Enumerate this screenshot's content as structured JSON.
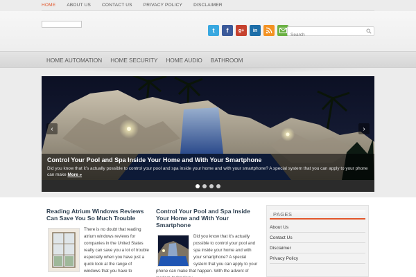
{
  "top_nav": {
    "items": [
      "HOME",
      "ABOUT US",
      "CONTACT US",
      "PRIVACY POLICY",
      "DISCLAIMER"
    ]
  },
  "header": {
    "social_icons": [
      "twitter-icon",
      "facebook-icon",
      "google-plus-icon",
      "linkedin-icon",
      "rss-icon",
      "mail-icon"
    ],
    "social_glyphs": [
      "t",
      "f",
      "g+",
      "in",
      "",
      ""
    ],
    "search_placeholder": "Search"
  },
  "main_nav": {
    "items": [
      "HOME AUTOMATION",
      "HOME SECURITY",
      "HOME AUDIO",
      "BATHROOM"
    ]
  },
  "slider": {
    "title": "Control Your Pool and Spa Inside Your Home and With Your Smartphone",
    "text": "Did you know that it’s actually possible to control your pool and spa inside your home and with your smartphone? A special system that you can apply to your phone can make",
    "more_label": "More »",
    "prev_glyph": "‹",
    "next_glyph": "›",
    "dots": 4,
    "active_dot": 0
  },
  "posts": [
    {
      "title": "Reading Atrium Windows Reviews Can Save You So Much Trouble",
      "excerpt": "There is no doubt that reading atrium windows reviews for companies in the United States really can save you a lot of trouble especially when you have just a quick look at the range of windows that you have to"
    },
    {
      "title": "Control Your Pool and Spa Inside Your Home and With Your Smartphone",
      "excerpt": "Did you know that it’s actually possible to control your pool and spa inside your home and with your smartphone? A special system that you can apply to your phone can make that happen. With the advent of modern technology"
    }
  ],
  "sidebar": {
    "title": "PAGES",
    "items": [
      "About Us",
      "Contact Us",
      "Disclaimer",
      "Privacy Policy"
    ]
  },
  "colors": {
    "accent": "#e2562a",
    "post_title": "#2d3f50"
  }
}
